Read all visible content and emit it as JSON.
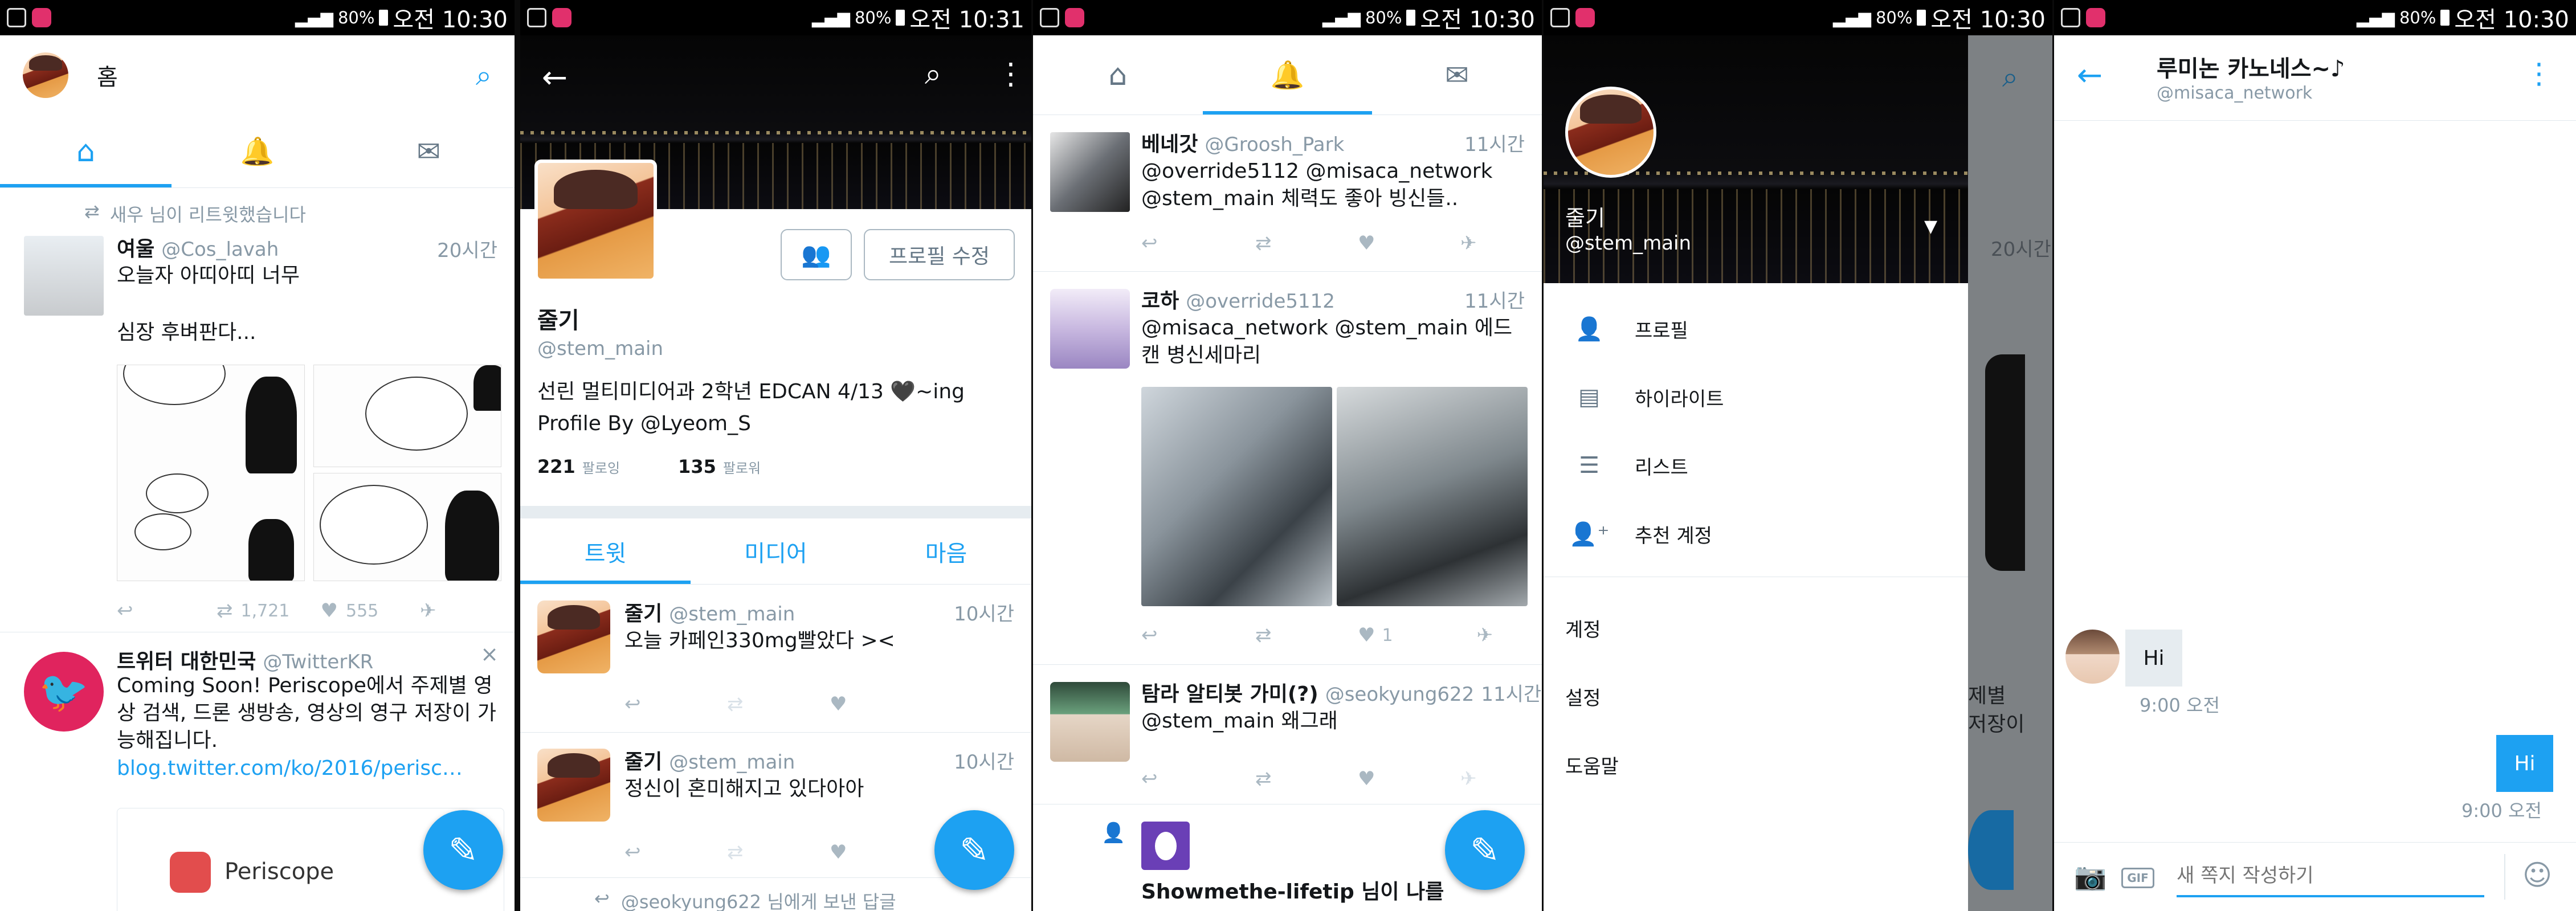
{
  "status": [
    {
      "battery": "80%",
      "time": "오전 10:30"
    },
    {
      "battery": "80%",
      "time": "오전 10:31"
    },
    {
      "battery": "80%",
      "time": "오전 10:30"
    },
    {
      "battery": "80%",
      "time": "오전 10:30"
    },
    {
      "battery": "80%",
      "time": "오전 10:30"
    }
  ],
  "colors": {
    "accent": "#1da1f2",
    "text": "#14171a",
    "gray": "#8899a6",
    "border": "#e1e8ed"
  },
  "home": {
    "title": "홈",
    "retweet_note": "새우 님이 리트윗했습니다",
    "tweet1": {
      "name": "여울",
      "handle": "@Cos_lavah",
      "time": "20시간",
      "line1": "오늘자 아띠아띠 너무",
      "line2": "심장 후벼판다...",
      "retweets": "1,721",
      "likes": "555"
    },
    "tweet2": {
      "name": "트위터 대한민국",
      "handle": "@TwitterKR",
      "text1": "Coming Soon! Periscope에서 주제별 영상 검색, 드론 생방송, 영상의 영구 저장이 가능해집니다.",
      "link": "blog.twitter.com/ko/2016/perisc…",
      "card": "Periscope"
    }
  },
  "profile": {
    "name": "줄기",
    "handle": "@stem_main",
    "edit_button": "프로필 수정",
    "bio": "선린 멀티미디어과 2학년 EDCAN 4/13 🖤~ing Profile By @Lyeom_S",
    "following_count": "221",
    "following_label": "팔로잉",
    "followers_count": "135",
    "followers_label": "팔로워",
    "tabs": [
      "트윗",
      "미디어",
      "마음"
    ],
    "tweets": [
      {
        "name": "줄기",
        "handle": "@stem_main",
        "time": "10시간",
        "text": "오늘 카페인330mg빨았다 ><"
      },
      {
        "name": "줄기",
        "handle": "@stem_main",
        "time": "10시간",
        "text": "정신이 혼미해지고 있다아아"
      }
    ],
    "footer_note": "@seokyung622 님에게 보낸 답글"
  },
  "notifications": {
    "items": [
      {
        "name": "베네갓",
        "handle": "@Groosh_Park",
        "time": "11시간",
        "text": "@override5112 @misaca_network @stem_main 체력도 좋아 빙신들.."
      },
      {
        "name": "코하",
        "handle": "@override5112",
        "time": "11시간",
        "text": "@misaca_network @stem_main 에드캔 병신세마리",
        "likes": "1"
      },
      {
        "name": "탐라 알티봇 가미(?)",
        "handle": "@seokyung622",
        "time": "11시간",
        "text": "@stem_main 왜그래"
      }
    ],
    "follow_note": "Showmethe-lifetip 님이 나를"
  },
  "drawer": {
    "name": "줄기",
    "handle": "@stem_main",
    "items": [
      "프로필",
      "하이라이트",
      "리스트",
      "추천 계정"
    ],
    "bottom": [
      "계정",
      "설정",
      "도움말"
    ],
    "bg_time": "20시간",
    "bg_text1": "제별",
    "bg_text2": "저장이"
  },
  "dm": {
    "title": "루미논 카노네스~♪",
    "handle": "@misaca_network",
    "received": {
      "text": "Hi",
      "time": "9:00 오전"
    },
    "sent": {
      "text": "Hi",
      "time": "9:00 오전"
    },
    "placeholder": "새 쪽지 작성하기",
    "gif_label": "GIF"
  }
}
